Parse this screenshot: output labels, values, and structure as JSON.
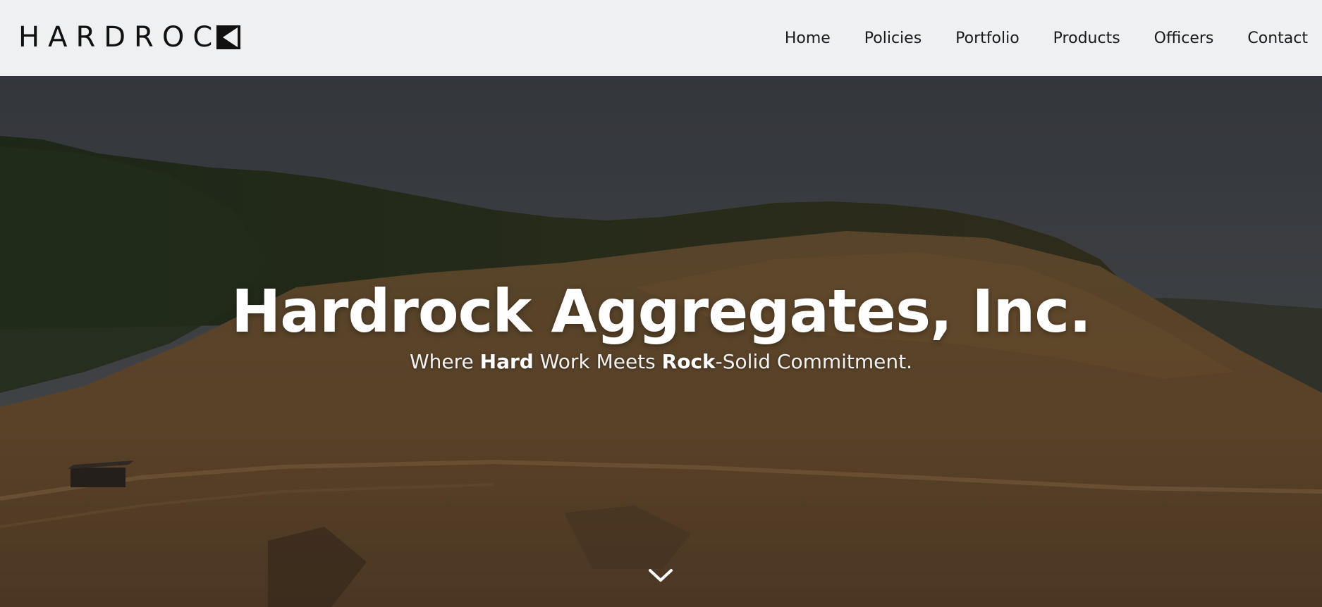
{
  "header": {
    "logo_text": "HARDROC",
    "logo_icon": "hardrock-k-mark-icon",
    "nav": [
      "Home",
      "Policies",
      "Portfolio",
      "Products",
      "Officers",
      "Contact"
    ]
  },
  "hero": {
    "title": "Hardrock Aggregates, Inc.",
    "tagline": {
      "part1": "Where ",
      "bold1": "Hard",
      "part2": " Work Meets ",
      "bold2": "Rock",
      "part3": "-Solid Commitment."
    },
    "scroll_icon": "chevron-down-icon"
  },
  "colors": {
    "navbar_bg": "#eef0f1",
    "nav_text": "#1a1a1a",
    "hero_text": "#ffffff"
  }
}
